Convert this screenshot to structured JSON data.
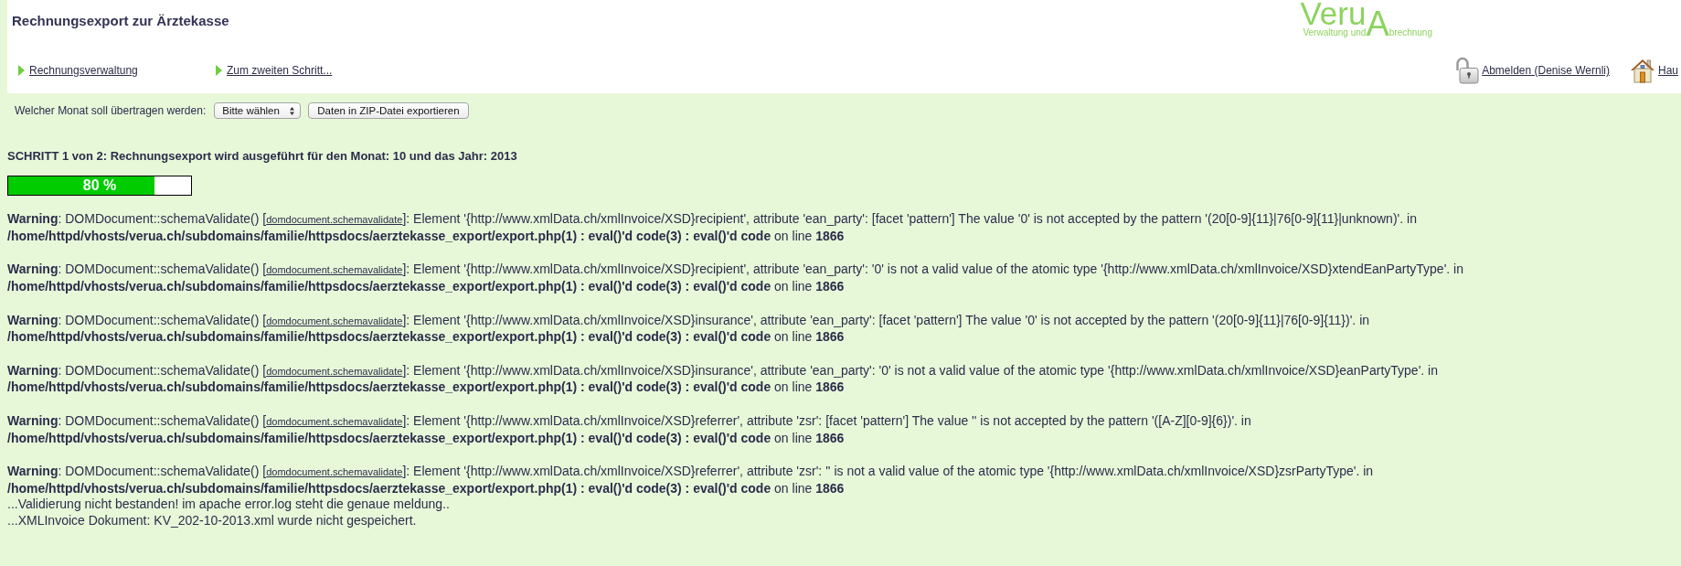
{
  "header": {
    "title": "Rechnungsexport zur Ärztekasse",
    "logo": {
      "word": "Veru",
      "initial": "A",
      "tagline_left": "Verwaltung und",
      "tagline_right": "brechnung"
    }
  },
  "nav": {
    "left": [
      {
        "label": "Rechnungsverwaltung"
      },
      {
        "label": "Zum zweiten Schritt..."
      }
    ],
    "right": [
      {
        "label": "Abmelden (Denise Wernli)",
        "kind": "logout"
      },
      {
        "label": "Hau",
        "kind": "home"
      }
    ]
  },
  "export_form": {
    "label": "Welcher Monat soll übertragen werden:",
    "select": {
      "value": "Bitte wählen"
    },
    "button": "Daten in ZIP-Datei exportieren"
  },
  "step": {
    "heading": "SCHRITT 1 von 2: Rechnungsexport wird ausgeführt für den Monat: 10 und das Jahr: 2013"
  },
  "progress": {
    "level": 0.8,
    "label": "80 %"
  },
  "warnings": [
    {
      "before_link": "**Warning**: DOMDocument::schemaValidate() [",
      "link": "domdocument.schemavalidate",
      "message": "]: Element '{http://www.xmlData.ch/xmlInvoice/XSD}recipient', attribute 'ean_party': [facet 'pattern'] The value '0' is not accepted by the pattern '(20[0-9]{11}|76[0-9]{11}|unknown)'. in",
      "location": "**/home/httpd/vhosts/verua.ch/subdomains/familie/httpsdocs/aerztekasse_export/export.php(1) : eval()'d code(3) : eval()'d code** on line **1866**"
    },
    {
      "before_link": "**Warning**: DOMDocument::schemaValidate() [",
      "link": "domdocument.schemavalidate",
      "message": "]: Element '{http://www.xmlData.ch/xmlInvoice/XSD}recipient', attribute 'ean_party': '0' is not a valid value of the atomic type '{http://www.xmlData.ch/xmlInvoice/XSD}xtendEanPartyType'. in",
      "location": "**/home/httpd/vhosts/verua.ch/subdomains/familie/httpsdocs/aerztekasse_export/export.php(1) : eval()'d code(3) : eval()'d code** on line **1866**"
    },
    {
      "before_link": "**Warning**: DOMDocument::schemaValidate() [",
      "link": "domdocument.schemavalidate",
      "message": "]: Element '{http://www.xmlData.ch/xmlInvoice/XSD}insurance', attribute 'ean_party': [facet 'pattern'] The value '0' is not accepted by the pattern '(20[0-9]{11}|76[0-9]{11})'. in",
      "location": "**/home/httpd/vhosts/verua.ch/subdomains/familie/httpsdocs/aerztekasse_export/export.php(1) : eval()'d code(3) : eval()'d code** on line **1866**"
    },
    {
      "before_link": "**Warning**: DOMDocument::schemaValidate() [",
      "link": "domdocument.schemavalidate",
      "message": "]: Element '{http://www.xmlData.ch/xmlInvoice/XSD}insurance', attribute 'ean_party': '0' is not a valid value of the atomic type '{http://www.xmlData.ch/xmlInvoice/XSD}eanPartyType'. in",
      "location": "**/home/httpd/vhosts/verua.ch/subdomains/familie/httpsdocs/aerztekasse_export/export.php(1) : eval()'d code(3) : eval()'d code** on line **1866**"
    },
    {
      "before_link": "**Warning**: DOMDocument::schemaValidate() [",
      "link": "domdocument.schemavalidate",
      "message": "]: Element '{http://www.xmlData.ch/xmlInvoice/XSD}referrer', attribute 'zsr': [facet 'pattern'] The value '' is not accepted by the pattern '([A-Z][0-9]{6})'. in",
      "location": "**/home/httpd/vhosts/verua.ch/subdomains/familie/httpsdocs/aerztekasse_export/export.php(1) : eval()'d code(3) : eval()'d code** on line **1866**"
    },
    {
      "before_link": "**Warning**: DOMDocument::schemaValidate() [",
      "link": "domdocument.schemavalidate",
      "message": "]: Element '{http://www.xmlData.ch/xmlInvoice/XSD}referrer', attribute 'zsr': '' is not a valid value of the atomic type '{http://www.xmlData.ch/xmlInvoice/XSD}zsrPartyType'. in",
      "location": "**/home/httpd/vhosts/verua.ch/subdomains/familie/httpsdocs/aerztekasse_export/export.php(1) : eval()'d code(3) : eval()'d code** on line **1866**"
    }
  ],
  "messages": [
    "...Validierung nicht bestanden! im apache error.log steht die genaue meldung..",
    "...XMLInvoice Dokument: KV_202-10-2013.xml wurde nicht gespeichert."
  ]
}
